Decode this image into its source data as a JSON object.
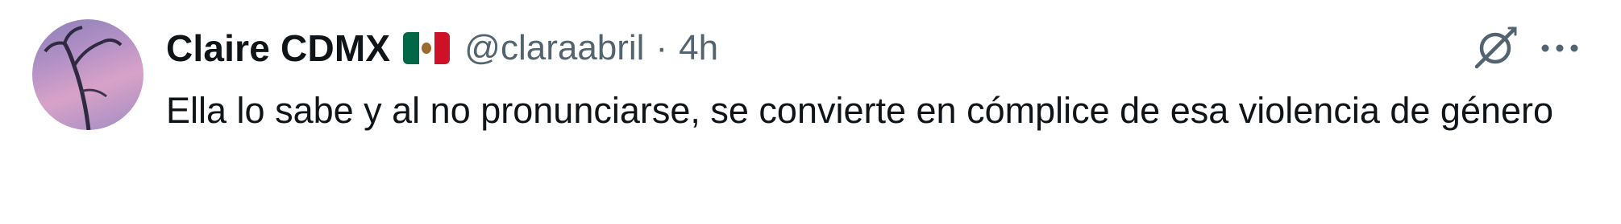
{
  "tweet": {
    "author": {
      "display_name": "Claire CDMX",
      "flag_icon": "mexico-flag-icon",
      "handle": "@claraabril",
      "separator": "·",
      "timestamp": "4h"
    },
    "actions": {
      "grok_icon": "grok-icon",
      "more_icon": "more-options-icon"
    },
    "text": "Ella lo sabe y al no pronunciarse, se convierte en cómplice de esa violencia de género"
  },
  "colors": {
    "text_primary": "#0f1419",
    "text_secondary": "#536471",
    "flag_green": "#006847",
    "flag_white": "#ffffff",
    "flag_red": "#ce1126"
  }
}
